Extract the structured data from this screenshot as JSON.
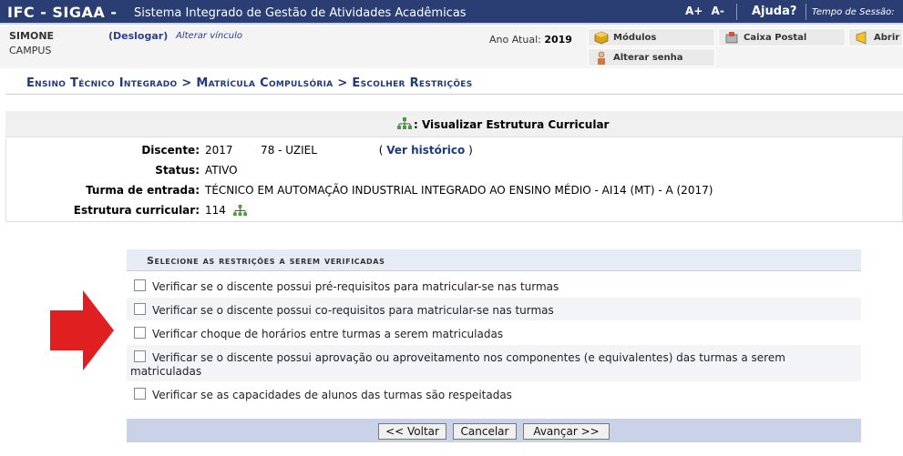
{
  "header": {
    "logo": "IFC - SIGAA -",
    "system_name": "Sistema Integrado de Gestão de Atividades Acadêmicas",
    "font_increase": "A+",
    "font_decrease": "A-",
    "help": "Ajuda?",
    "session_label": "Tempo de Sessão:"
  },
  "user": {
    "name": "SIMONE",
    "campus": "CAMPUS",
    "logout": "(Deslogar)",
    "change_link": "Alterar vínculo",
    "year_label": "Ano Atual:",
    "year_value": "2019"
  },
  "menu": {
    "modules": "Módulos",
    "mailbox": "Caixa Postal",
    "open": "Abrir",
    "change_password": "Alterar senha"
  },
  "breadcrumb": "Ensino Técnico Integrado > Matrícula Compulsória > Escolher Restrições",
  "visualizar": "Visualizar Estrutura Curricular",
  "student": {
    "discente_label": "Discente:",
    "discente_value": "2017        78 - UZIEL",
    "historico": "Ver histórico",
    "status_label": "Status:",
    "status_value": "ATIVO",
    "turma_label": "Turma de entrada:",
    "turma_value": "TÉCNICO EM AUTOMAÇÃO INDUSTRIAL INTEGRADO AO ENSINO MÉDIO - AI14 (MT) - A (2017)",
    "estrutura_label": "Estrutura curricular:",
    "estrutura_value": "114"
  },
  "restrictions": {
    "title": "Selecione as restrições a serem verificadas",
    "options": [
      "Verificar se o discente possui pré-requisitos para matricular-se nas turmas",
      "Verificar se o discente possui co-requisitos para matricular-se nas turmas",
      "Verificar choque de horários entre turmas a serem matriculadas",
      "Verificar se o discente possui aprovação ou aproveitamento nos componentes (e equivalentes) das turmas a serem matriculadas",
      "Verificar se as capacidades de alunos das turmas são respeitadas"
    ]
  },
  "buttons": {
    "back": "<< Voltar",
    "cancel": "Cancelar",
    "next": "Avançar >>"
  },
  "colors": {
    "header_bg": "#2b3e73",
    "link": "#1f3a7a",
    "arrow": "#e02020"
  }
}
